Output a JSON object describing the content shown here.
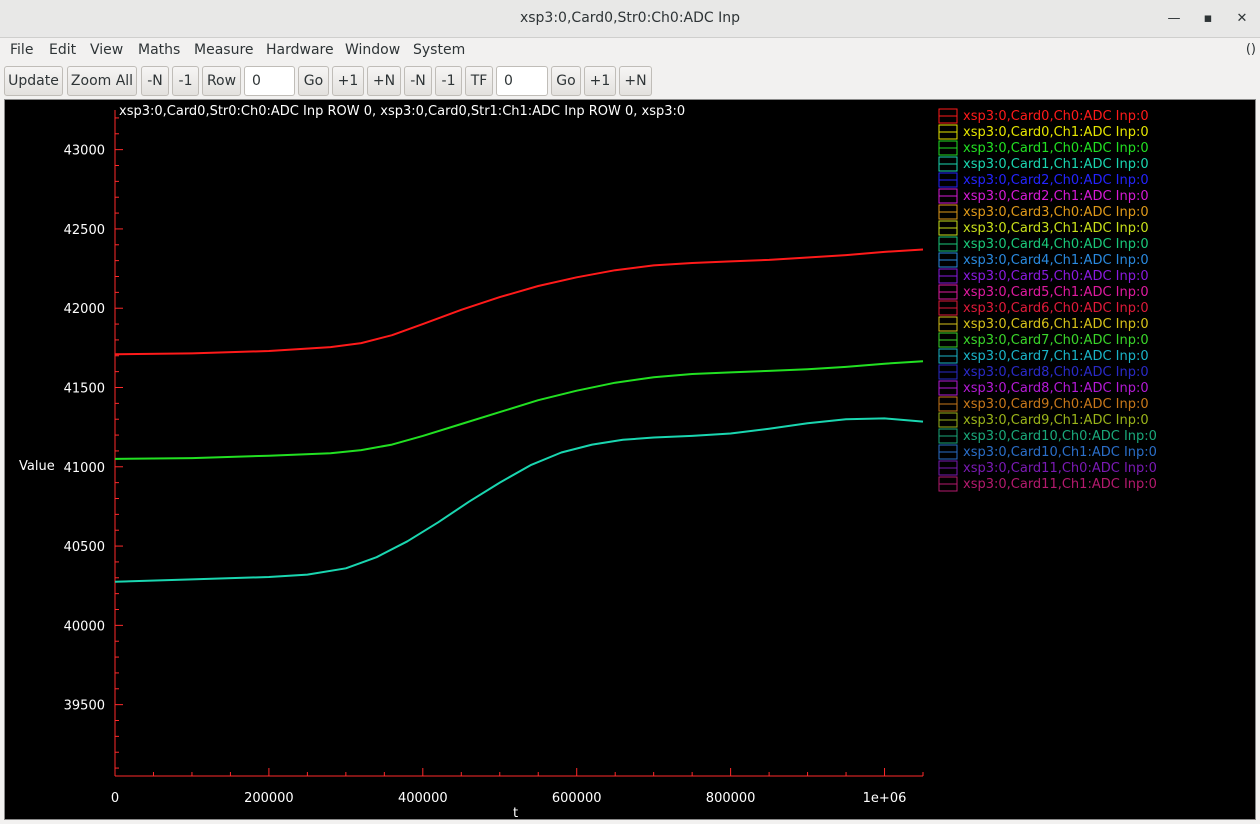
{
  "window": {
    "title": "xsp3:0,Card0,Str0:Ch0:ADC Inp",
    "minimize_glyph": "—",
    "maximize_glyph": "▪",
    "close_glyph": "✕"
  },
  "menu": {
    "items": [
      {
        "label": "File",
        "x": 10
      },
      {
        "label": "Edit",
        "x": 49
      },
      {
        "label": "View",
        "x": 90
      },
      {
        "label": "Maths",
        "x": 138
      },
      {
        "label": "Measure",
        "x": 194
      },
      {
        "label": "Hardware",
        "x": 266
      },
      {
        "label": "Window",
        "x": 345
      },
      {
        "label": "System",
        "x": 413
      }
    ],
    "extra": "()"
  },
  "toolbar": {
    "update": "Update",
    "zoom_all": "Zoom All",
    "minus_n_1": "-N",
    "minus_1_1": "-1",
    "row": "Row",
    "row_value": "0",
    "go_1": "Go",
    "plus_1_1": "+1",
    "plus_n_1": "+N",
    "minus_n_2": "-N",
    "minus_1_2": "-1",
    "tf": "TF",
    "tf_value": "0",
    "go_2": "Go",
    "plus_1_2": "+1",
    "plus_n_2": "+N"
  },
  "chart_data": {
    "type": "line",
    "title": "xsp3:0,Card0,Str0:Ch0:ADC Inp ROW 0, xsp3:0,Card0,Str1:Ch1:ADC Inp ROW 0, xsp3:0",
    "xlabel": "t",
    "ylabel": "Value",
    "xlim": [
      0,
      1050000
    ],
    "ylim": [
      39050,
      43250
    ],
    "x_ticks": [
      {
        "value": 0,
        "label": "0"
      },
      {
        "value": 200000,
        "label": "200000"
      },
      {
        "value": 400000,
        "label": "400000"
      },
      {
        "value": 600000,
        "label": "600000"
      },
      {
        "value": 800000,
        "label": "800000"
      },
      {
        "value": 1000000,
        "label": "1e+06"
      }
    ],
    "y_ticks": [
      {
        "value": 39500,
        "label": "39500"
      },
      {
        "value": 40000,
        "label": "40000"
      },
      {
        "value": 40500,
        "label": "40500"
      },
      {
        "value": 41000,
        "label": "41000"
      },
      {
        "value": 41500,
        "label": "41500"
      },
      {
        "value": 42000,
        "label": "42000"
      },
      {
        "value": 42500,
        "label": "42500"
      },
      {
        "value": 43000,
        "label": "43000"
      }
    ],
    "grid": false,
    "legend_position": "top-right",
    "series": [
      {
        "name": "xsp3:0,Card0,Ch0:ADC Inp:0",
        "color": "#ff1a1a",
        "x": [
          0,
          100000,
          200000,
          280000,
          320000,
          360000,
          400000,
          450000,
          500000,
          550000,
          600000,
          650000,
          700000,
          750000,
          800000,
          850000,
          900000,
          950000,
          1000000,
          1050000
        ],
        "y": [
          41710,
          41715,
          41730,
          41755,
          41780,
          41830,
          41900,
          41990,
          42070,
          42140,
          42195,
          42240,
          42270,
          42285,
          42295,
          42305,
          42320,
          42335,
          42355,
          42370
        ]
      },
      {
        "name": "xsp3:0,Card0,Ch1:ADC Inp:0",
        "color": "#e6e600",
        "x": [],
        "y": []
      },
      {
        "name": "xsp3:0,Card1,Ch0:ADC Inp:0",
        "color": "#22e022",
        "x": [
          0,
          100000,
          200000,
          280000,
          320000,
          360000,
          400000,
          450000,
          500000,
          550000,
          600000,
          650000,
          700000,
          750000,
          800000,
          850000,
          900000,
          950000,
          1000000,
          1050000
        ],
        "y": [
          41050,
          41055,
          41070,
          41085,
          41105,
          41140,
          41195,
          41270,
          41345,
          41420,
          41480,
          41530,
          41565,
          41585,
          41595,
          41605,
          41615,
          41630,
          41650,
          41665
        ]
      },
      {
        "name": "xsp3:0,Card1,Ch1:ADC Inp:0",
        "color": "#1ad6b0",
        "x": [
          0,
          100000,
          200000,
          250000,
          300000,
          340000,
          380000,
          420000,
          460000,
          500000,
          540000,
          580000,
          620000,
          660000,
          700000,
          750000,
          800000,
          850000,
          900000,
          950000,
          1000000,
          1050000
        ],
        "y": [
          40275,
          40290,
          40305,
          40320,
          40360,
          40430,
          40530,
          40650,
          40780,
          40900,
          41010,
          41090,
          41140,
          41170,
          41185,
          41195,
          41210,
          41240,
          41275,
          41300,
          41305,
          41285
        ]
      },
      {
        "name": "xsp3:0,Card2,Ch0:ADC Inp:0",
        "color": "#2424ff",
        "x": [],
        "y": []
      },
      {
        "name": "xsp3:0,Card2,Ch1:ADC Inp:0",
        "color": "#d61ad6",
        "x": [],
        "y": []
      },
      {
        "name": "xsp3:0,Card3,Ch0:ADC Inp:0",
        "color": "#e09a1a",
        "x": [],
        "y": []
      },
      {
        "name": "xsp3:0,Card3,Ch1:ADC Inp:0",
        "color": "#c8e01a",
        "x": [],
        "y": []
      },
      {
        "name": "xsp3:0,Card4,Ch0:ADC Inp:0",
        "color": "#1ac87a",
        "x": [],
        "y": []
      },
      {
        "name": "xsp3:0,Card4,Ch1:ADC Inp:0",
        "color": "#2a8ae0",
        "x": [],
        "y": []
      },
      {
        "name": "xsp3:0,Card5,Ch0:ADC Inp:0",
        "color": "#8a1ae0",
        "x": [],
        "y": []
      },
      {
        "name": "xsp3:0,Card5,Ch1:ADC Inp:0",
        "color": "#e01aa0",
        "x": [],
        "y": []
      },
      {
        "name": "xsp3:0,Card6,Ch0:ADC Inp:0",
        "color": "#e01a3a",
        "x": [],
        "y": []
      },
      {
        "name": "xsp3:0,Card6,Ch1:ADC Inp:0",
        "color": "#d6c21a",
        "x": [],
        "y": []
      },
      {
        "name": "xsp3:0,Card7,Ch0:ADC Inp:0",
        "color": "#3ad62a",
        "x": [],
        "y": []
      },
      {
        "name": "xsp3:0,Card7,Ch1:ADC Inp:0",
        "color": "#1ab4c8",
        "x": [],
        "y": []
      },
      {
        "name": "xsp3:0,Card8,Ch0:ADC Inp:0",
        "color": "#2a2ac8",
        "x": [],
        "y": []
      },
      {
        "name": "xsp3:0,Card8,Ch1:ADC Inp:0",
        "color": "#b41ad6",
        "x": [],
        "y": []
      },
      {
        "name": "xsp3:0,Card9,Ch0:ADC Inp:0",
        "color": "#c8781a",
        "x": [],
        "y": []
      },
      {
        "name": "xsp3:0,Card9,Ch1:ADC Inp:0",
        "color": "#9ab41a",
        "x": [],
        "y": []
      },
      {
        "name": "xsp3:0,Card10,Ch0:ADC Inp:0",
        "color": "#1aa87a",
        "x": [],
        "y": []
      },
      {
        "name": "xsp3:0,Card10,Ch1:ADC Inp:0",
        "color": "#2a6ec8",
        "x": [],
        "y": []
      },
      {
        "name": "xsp3:0,Card11,Ch0:ADC Inp:0",
        "color": "#7a1ab4",
        "x": [],
        "y": []
      },
      {
        "name": "xsp3:0,Card11,Ch1:ADC Inp:0",
        "color": "#b41a6e",
        "x": [],
        "y": []
      }
    ]
  }
}
